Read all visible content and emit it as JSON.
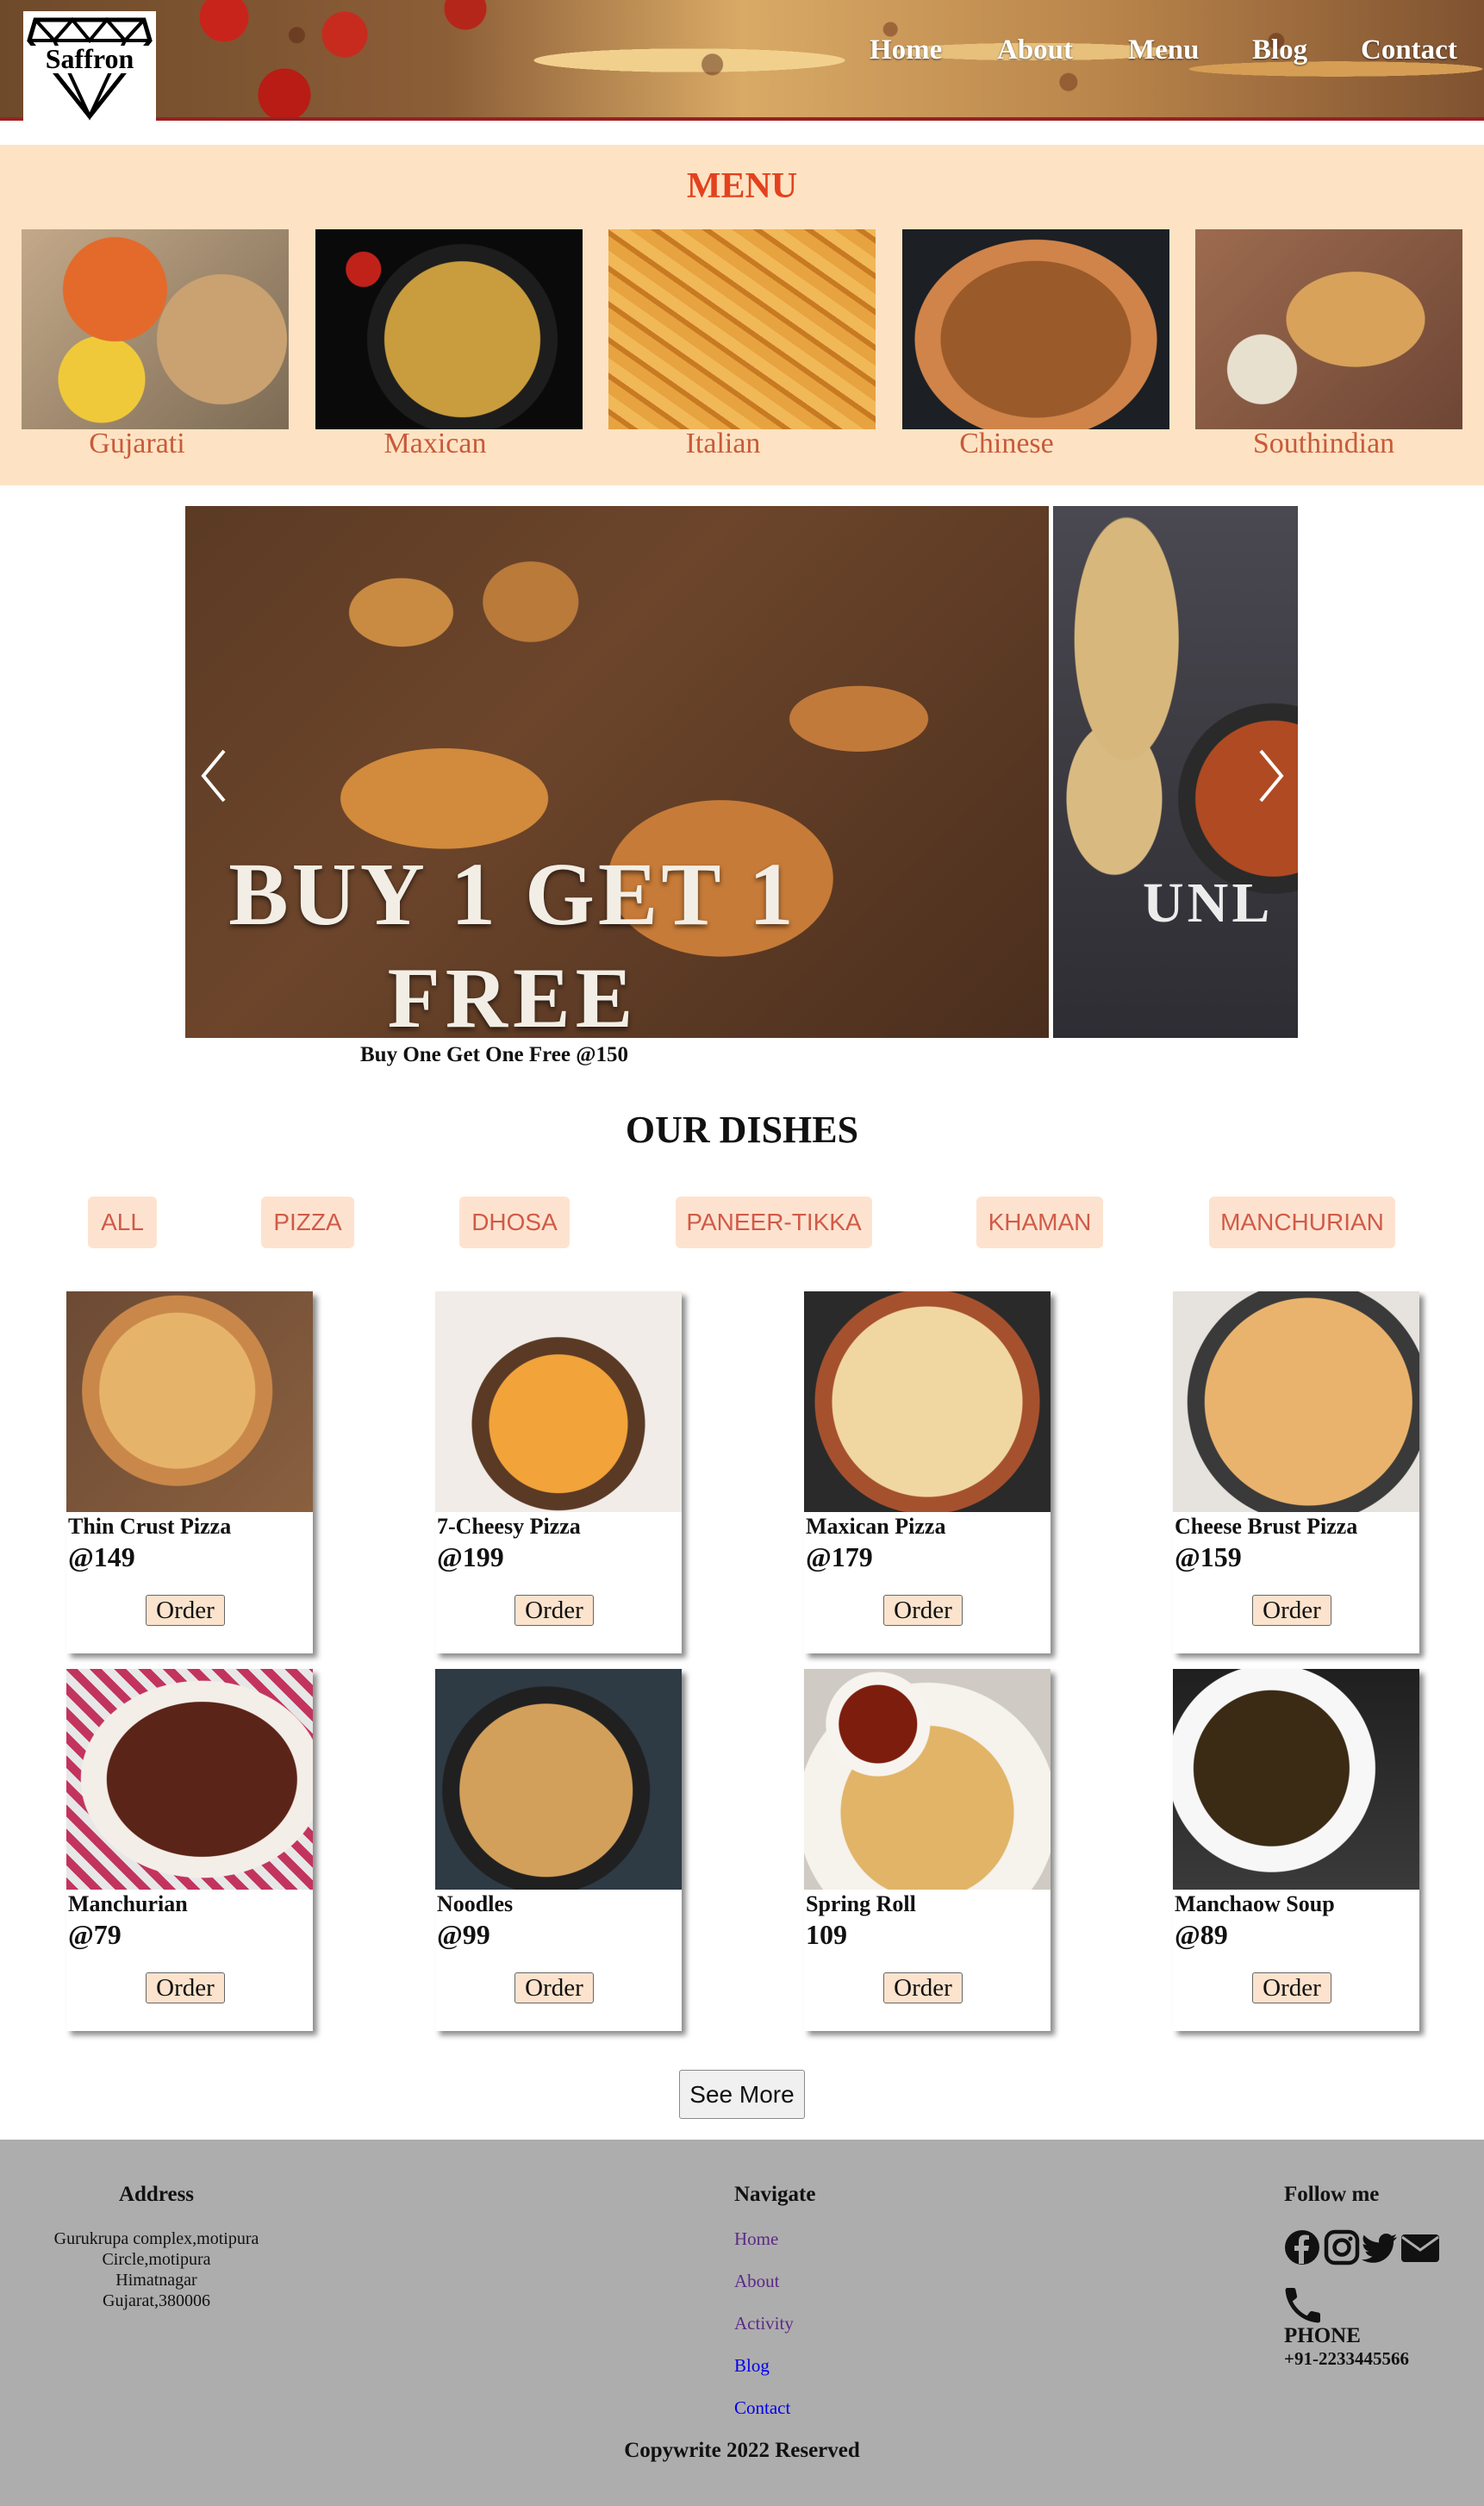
{
  "header": {
    "logo_text": "Saffron",
    "nav": [
      "Home",
      "About",
      "Menu",
      "Blog",
      "Contact"
    ]
  },
  "menu": {
    "title": "MENU",
    "categories": [
      "Gujarati",
      "Maxican",
      "Italian",
      "Chinese",
      "Southindian"
    ]
  },
  "carousel": {
    "slide1_text_line1": "BUY 1 GET 1",
    "slide1_text_line2": "FREE",
    "slide2_text": "UNL",
    "caption": "Buy One Get One Free @150"
  },
  "dishes": {
    "title": "OUR DISHES",
    "filters": [
      "ALL",
      "PIZZA",
      "DHOSA",
      "PANEER-TIKKA",
      "KHAMAN",
      "MANCHURIAN"
    ],
    "items": [
      {
        "name": "Thin Crust Pizza",
        "price": "@149",
        "order_label": "Order"
      },
      {
        "name": "7-Cheesy Pizza",
        "price": "@199",
        "order_label": "Order"
      },
      {
        "name": "Maxican Pizza",
        "price": "@179",
        "order_label": "Order"
      },
      {
        "name": "Cheese Brust Pizza",
        "price": "@159",
        "order_label": "Order"
      },
      {
        "name": "Manchurian",
        "price": "@79",
        "order_label": "Order"
      },
      {
        "name": "Noodles",
        "price": "@99",
        "order_label": "Order"
      },
      {
        "name": "Spring Roll",
        "price": "109",
        "order_label": "Order"
      },
      {
        "name": "Manchaow Soup",
        "price": "@89",
        "order_label": "Order"
      }
    ],
    "see_more": "See More"
  },
  "footer": {
    "address_heading": "Address",
    "address_lines": [
      "Gurukrupa complex,motipura",
      "Circle,motipura",
      "Himatnagar",
      "Gujarat,380006"
    ],
    "navigate_heading": "Navigate",
    "nav_links": [
      "Home",
      "About",
      "Activity",
      "Blog",
      "Contact"
    ],
    "follow_heading": "Follow me",
    "social_icons": [
      "facebook-icon",
      "instagram-icon",
      "twitter-icon",
      "envelope-icon"
    ],
    "phone_label": "PHONE",
    "phone_number": "+91-2233445566",
    "copyright": "Copywrite 2022 Reserved"
  },
  "colors": {
    "menu_bg": "#fde3c3",
    "menu_title": "#e4411e",
    "category_label": "#c85a3a",
    "filter_bg": "#fde3cf",
    "filter_text": "#d25a48",
    "footer_bg": "#aeadad",
    "visited_link": "#5b2a86",
    "link": "#0000ee"
  }
}
